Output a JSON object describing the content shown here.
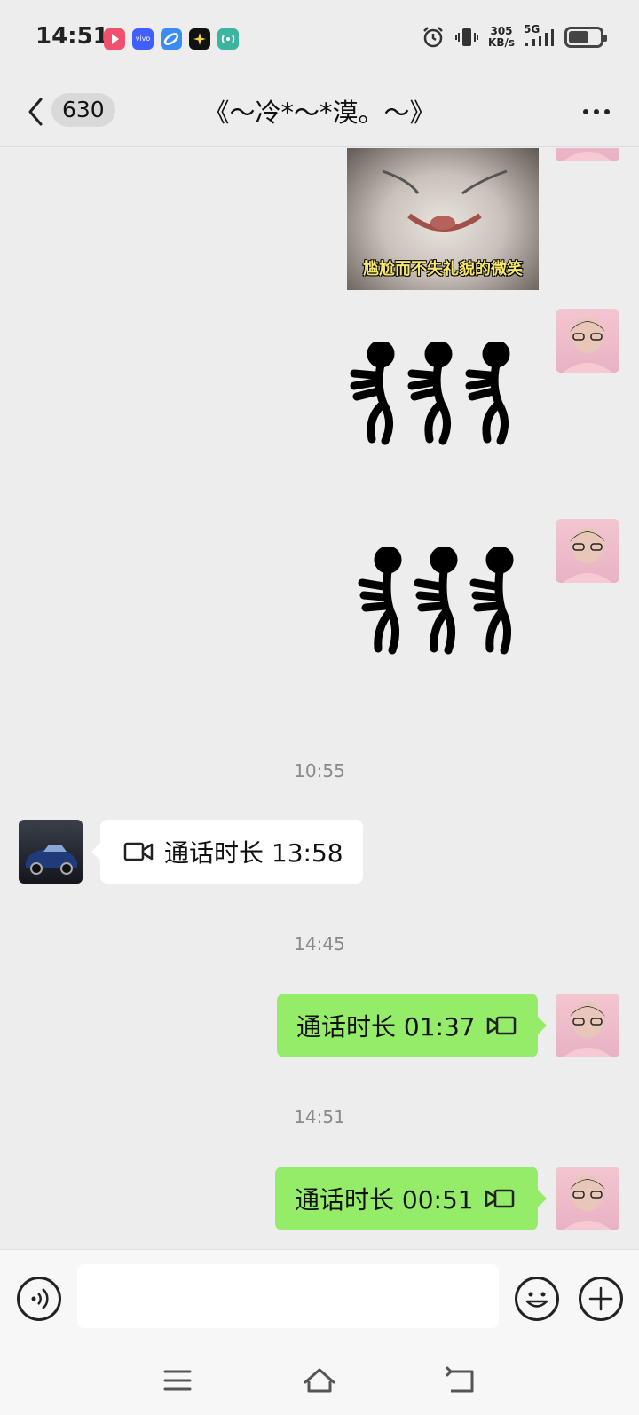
{
  "status_bar": {
    "time": "14:51",
    "net_speed_value": "305",
    "net_speed_unit": "KB/s",
    "network_type": "5G",
    "app_icons": [
      "video-app-icon",
      "vivo-icon",
      "browser-icon",
      "sparkle-icon",
      "wifi-hotspot-icon"
    ],
    "colors": {
      "video": "#f0506e",
      "vivo": "#415fff",
      "browser": "#3a8cf0",
      "sparkle": "#111111",
      "hotspot": "#3bb5a0"
    }
  },
  "header": {
    "unread_count": "630",
    "title": "《～冷*～*漠。～》",
    "more_label": "···"
  },
  "messages": {
    "meme_caption": "尴尬而不失礼貌的微笑",
    "timestamp_1": "10:55",
    "call_in_text": "通话时长 13:58",
    "timestamp_2": "14:45",
    "call_out_1_text": "通话时长 01:37",
    "timestamp_3": "14:51",
    "call_out_2_text": "通话时长 00:51"
  },
  "input": {
    "placeholder": ""
  },
  "colors": {
    "background": "#ededed",
    "bubble_sent": "#95ec69",
    "bubble_received": "#ffffff",
    "timestamp": "#8a8a8a"
  }
}
